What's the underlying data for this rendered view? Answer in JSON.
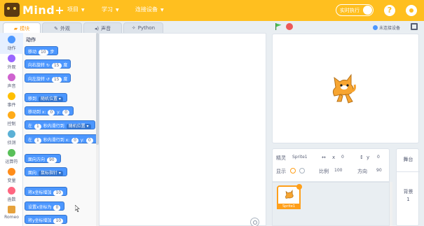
{
  "app": {
    "logo_text": "Mind+"
  },
  "menu": [
    {
      "label": "项目"
    },
    {
      "label": "学习"
    },
    {
      "label": "连接设备"
    }
  ],
  "realtime": {
    "label": "实时执行",
    "on": false
  },
  "tabs": [
    {
      "label": "模块",
      "icon": "blocks-icon",
      "active": true
    },
    {
      "label": "外观",
      "icon": "brush-icon"
    },
    {
      "label": "声音",
      "icon": "speaker-icon"
    },
    {
      "label": "Python",
      "icon": "python-icon"
    }
  ],
  "categories": [
    {
      "label": "动作",
      "color": "#4c97ff",
      "active": true
    },
    {
      "label": "外观",
      "color": "#9966ff"
    },
    {
      "label": "声音",
      "color": "#cf63cf"
    },
    {
      "label": "事件",
      "color": "#ffbf00"
    },
    {
      "label": "控制",
      "color": "#ffab19"
    },
    {
      "label": "侦测",
      "color": "#5cb1d6"
    },
    {
      "label": "运算符",
      "color": "#59c059"
    },
    {
      "label": "变量",
      "color": "#ff8c1a"
    },
    {
      "label": "函数",
      "color": "#ff6680"
    },
    {
      "label": "Romeo",
      "color": "#e6a23c"
    }
  ],
  "palette": {
    "title": "动作",
    "blocks": {
      "move": {
        "a": "移动",
        "n": "10",
        "b": "步"
      },
      "turn_right": {
        "a": "向右旋转 ↻",
        "n": "15",
        "b": "度"
      },
      "turn_left": {
        "a": "向左旋转 ↺",
        "n": "15",
        "b": "度"
      },
      "goto": {
        "a": "移到",
        "d": "随机位置 ▾"
      },
      "goto_xy": {
        "a": "移动到 x:",
        "x": "0",
        "m": "y:",
        "y": "0"
      },
      "glide": {
        "a": "在",
        "n": "1",
        "m": "秒内滑行到",
        "d": "随机位置 ▾"
      },
      "glide_xy": {
        "a": "在",
        "n": "1",
        "m": "秒内滑行到 x:",
        "x": "0",
        "k": "y:",
        "y": "0"
      },
      "point_dir": {
        "a": "面向方向",
        "n": "90"
      },
      "point_to": {
        "a": "面向",
        "d": "鼠标指针 ▾"
      },
      "change_x": {
        "a": "将x坐标增加",
        "n": "10"
      },
      "set_x": {
        "a": "设置x坐标为",
        "n": "0"
      },
      "change_y": {
        "a": "将y坐标增加",
        "n": "10"
      }
    }
  },
  "stage_header": {
    "device_label": "未连接设备"
  },
  "sprite": {
    "sprite_label": "精灵",
    "name": "Sprite1",
    "x_label": "x",
    "x": "0",
    "y_label": "y",
    "y": "0",
    "show_label": "显示",
    "size_label": "比例",
    "size": "100",
    "dir_label": "方向",
    "direction": "90",
    "thumb_name": "Sprite1"
  },
  "stage_panel": {
    "title": "舞台",
    "backdrop_label": "背景",
    "backdrop_count": "1"
  }
}
